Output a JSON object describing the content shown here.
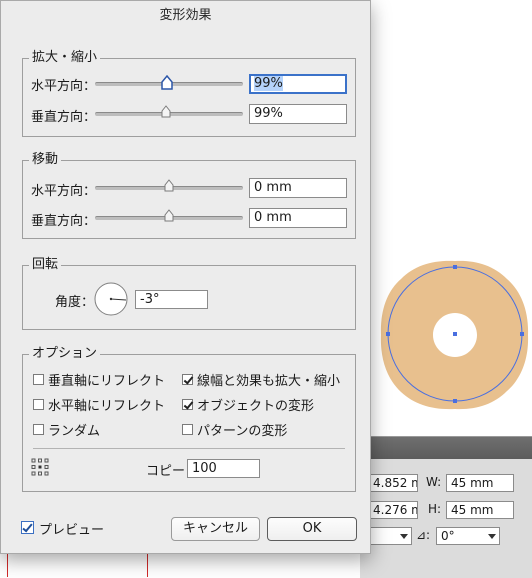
{
  "dialog": {
    "title": "変形効果",
    "scale": {
      "legend": "拡大・縮小",
      "horizontal_label": "水平方向：",
      "horizontal_value": "99%",
      "vertical_label": "垂直方向：",
      "vertical_value": "99%"
    },
    "move": {
      "legend": "移動",
      "horizontal_label": "水平方向：",
      "horizontal_value": "0 mm",
      "vertical_label": "垂直方向：",
      "vertical_value": "0 mm"
    },
    "rotate": {
      "legend": "回転",
      "angle_label": "角度：",
      "angle_value": "-3°"
    },
    "options": {
      "legend": "オプション",
      "reflect_vertical": {
        "label": "垂直軸にリフレクト",
        "checked": false
      },
      "reflect_horizontal": {
        "label": "水平軸にリフレクト",
        "checked": false
      },
      "random": {
        "label": "ランダム",
        "checked": false
      },
      "scale_strokes": {
        "label": "線幅と効果も拡大・縮小",
        "checked": true
      },
      "transform_objects": {
        "label": "オブジェクトの変形",
        "checked": true
      },
      "transform_patterns": {
        "label": "パターンの変形",
        "checked": false
      },
      "copies_label": "コピー",
      "copies_value": "100"
    },
    "preview": {
      "label": "プレビュー",
      "checked": true
    },
    "cancel_label": "キャンセル",
    "ok_label": "OK",
    "colors": {
      "accent": "#3b72c9",
      "selection": "#b5d3fb",
      "shape_fill": "#e8c08e",
      "path_stroke": "#4a6fe0"
    }
  },
  "transform_panel": {
    "x_value": "4.852 m",
    "y_value": "4.276 m",
    "w_label": "W:",
    "w_value": "45 mm",
    "h_label": "H:",
    "h_value": "45 mm",
    "shear_value": "0°"
  }
}
